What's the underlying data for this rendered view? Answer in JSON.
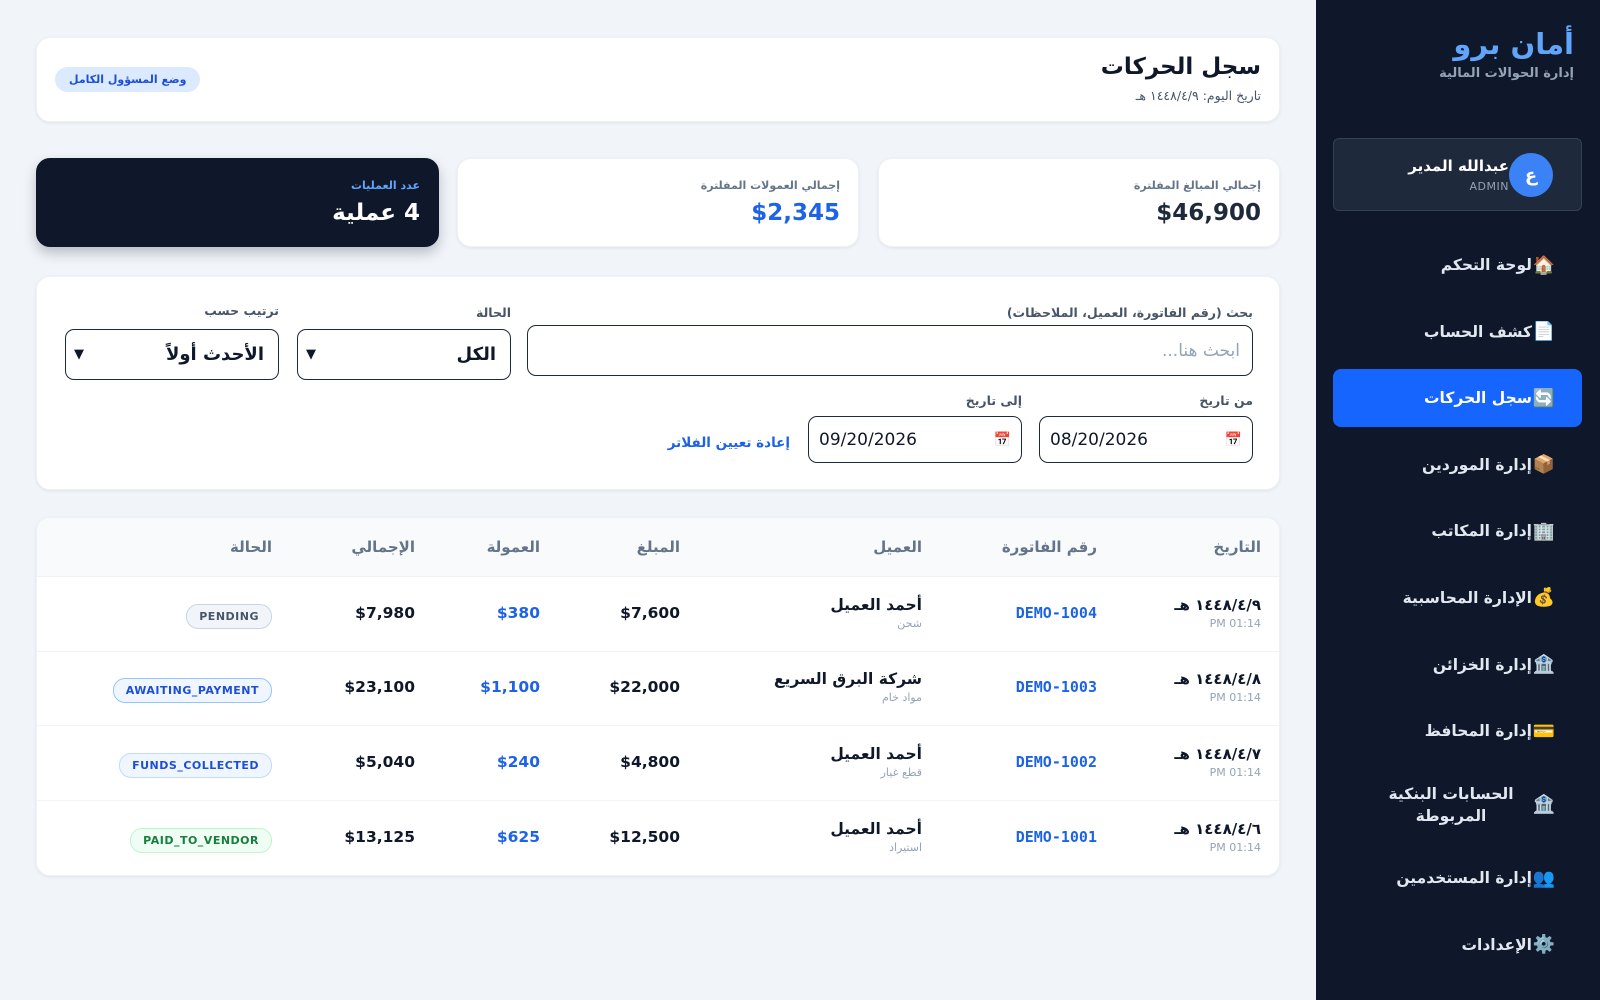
{
  "sidebar": {
    "brand_title": "أمان برو",
    "brand_subtitle": "إدارة الحوالات المالية",
    "user": {
      "avatar_letter": "ع",
      "name": "عبدالله المدير",
      "role": "ADMIN"
    },
    "items": [
      {
        "icon": "🏠",
        "icon_name": "home-icon",
        "label": "لوحة التحكم"
      },
      {
        "icon": "📄",
        "icon_name": "document-icon",
        "label": "كشف الحساب"
      },
      {
        "icon": "🔄",
        "icon_name": "refresh-icon",
        "label": "سجل الحركات"
      },
      {
        "icon": "📦",
        "icon_name": "package-icon",
        "label": "إدارة الموردين"
      },
      {
        "icon": "🏢",
        "icon_name": "office-building-icon",
        "label": "إدارة المكاتب"
      },
      {
        "icon": "💰",
        "icon_name": "money-bag-icon",
        "label": "الإدارة المحاسبية"
      },
      {
        "icon": "🏦",
        "icon_name": "bank-icon",
        "label": "إدارة الخزائن"
      },
      {
        "icon": "💳",
        "icon_name": "credit-card-icon",
        "label": "إدارة المحافظ"
      },
      {
        "icon": "🏦",
        "icon_name": "bank-icon",
        "label": "الحسابات البنكية المربوطة"
      },
      {
        "icon": "👥",
        "icon_name": "users-icon",
        "label": "إدارة المستخدمين"
      },
      {
        "icon": "⚙️",
        "icon_name": "gear-icon",
        "label": "الإعدادات"
      }
    ],
    "active_item": "سجل الحركات"
  },
  "header": {
    "title": "سجل الحركات",
    "date": "تاريخ اليوم: ١٤٤٨/٤/٩ هـ",
    "mode_badge": "وضع المسؤول الكامل"
  },
  "stats": [
    {
      "label": "إجمالي المبالغ المفلترة",
      "value": "$46,900"
    },
    {
      "label": "إجمالي العمولات المفلترة",
      "value": "$2,345"
    },
    {
      "label": "عدد العمليات",
      "value": "4 عملية"
    }
  ],
  "filters": {
    "search_label": "بحث (رقم الفاتورة، العميل، الملاحظات)",
    "search_placeholder": "ابحث هنا...",
    "status_label": "الحالة",
    "status_value": "الكل",
    "sort_label": "ترتيب حسب",
    "sort_value": "الأحدث أولاً",
    "from_label": "من تاريخ",
    "from_value": "08/20/2026",
    "to_label": "إلى تاريخ",
    "to_value": "09/20/2026",
    "reset_label": "إعادة تعيين الفلاتر"
  },
  "table": {
    "headers": {
      "date": "التاريخ",
      "invoice": "رقم الفاتورة",
      "customer": "العميل",
      "amount": "المبلغ",
      "commission": "العمولة",
      "total": "الإجمالي",
      "status": "الحالة"
    },
    "rows": [
      {
        "date": "١٤٤٨/٤/٩ هـ",
        "time": "01:14 PM",
        "invoice": "DEMO-1004",
        "customer": "أحمد العميل",
        "note": "شحن",
        "amount": "$7,600",
        "commission": "$380",
        "total": "$7,980",
        "status": "PENDING"
      },
      {
        "date": "١٤٤٨/٤/٨ هـ",
        "time": "01:14 PM",
        "invoice": "DEMO-1003",
        "customer": "شركة البرق السريع",
        "note": "مواد خام",
        "amount": "$22,000",
        "commission": "$1,100",
        "total": "$23,100",
        "status": "AWAITING_PAYMENT"
      },
      {
        "date": "١٤٤٨/٤/٧ هـ",
        "time": "01:14 PM",
        "invoice": "DEMO-1002",
        "customer": "أحمد العميل",
        "note": "قطع غيار",
        "amount": "$4,800",
        "commission": "$240",
        "total": "$5,040",
        "status": "FUNDS_COLLECTED"
      },
      {
        "date": "١٤٤٨/٤/٦ هـ",
        "time": "01:14 PM",
        "invoice": "DEMO-1001",
        "customer": "أحمد العميل",
        "note": "استيراد",
        "amount": "$12,500",
        "commission": "$625",
        "total": "$13,125",
        "status": "PAID_TO_VENDOR"
      }
    ]
  },
  "colors": {
    "sidebar_bg": "#0f172a",
    "accent": "#1665fe",
    "brand": "#60a5fa",
    "link": "#1d63e8"
  }
}
